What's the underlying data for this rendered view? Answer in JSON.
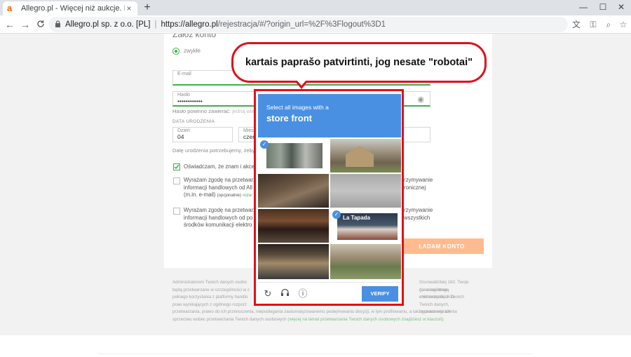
{
  "browser": {
    "tab_favicon": "a",
    "tab_title": "Allegro.pl - Więcej niż aukcje. Na",
    "tab_close": "×",
    "new_tab": "+",
    "win_min": "—",
    "win_max": "☐",
    "win_close": "✕",
    "url_org": "Allegro.pl sp. z o.o. [PL]",
    "url_host": "https://allegro.pl",
    "url_path": "/rejestracja/#/?origin_url=%2F%3Flogout%3D1"
  },
  "form": {
    "heading": "Załóż konto",
    "account_type": "zwykłe",
    "email_label": "E-mail",
    "password_label": "Hasło",
    "password_value": "••••••••••••",
    "password_hint": "Hasło powinno zawierać:",
    "password_hint_rule": "jedną wielką",
    "dob_heading": "DATA URODZENIA",
    "day_label": "Dzień",
    "day_value": "04",
    "month_label": "Mies",
    "month_value": "czer",
    "dob_hint": "Datę urodzenia potrzebujemy, żeby mó",
    "terms_text": "Oświadczam, że znam i akcep",
    "consent1_l1": "Wyrażam zgodę na przetwarz",
    "consent1_l1_right": "rzymywanie",
    "consent1_l2": "informacji handlowych od All",
    "consent1_l2_right": "ronicznej",
    "consent1_l3": "(m.in. e-mail)",
    "consent1_opt": "(opcjonalnie)",
    "consent1_more": "rozw",
    "consent2_l1": "Wyrażam zgodę na przetwarz",
    "consent2_l1_right": "rzymywanie",
    "consent2_l2": "informacji handlowych od po",
    "consent2_l2_right": "wszystkich",
    "consent2_l3": "środków komunikacji elektro",
    "submit": "ZAKŁADAM KONTO",
    "submit_visible": "ŁADAM KONTO"
  },
  "footer": {
    "l1a": "Administratorem Twoich danych osobo",
    "l1b": "Grunwaldzkiej 182. Twoje dane osobowe",
    "l2a": "będą przetwarzane w szczególności w c",
    "l2b": "ga usługi drogą elektroniczną oraz",
    "l3a": "pełnego korzystania z platformy handlo",
    "l3b": "enie wszystkich Twoich",
    "l4a": "praw wynikających z ogólnego rozporz",
    "l4b": "Twoich danych, ograniczenia ich",
    "l5": "przetwarzania, prawo do ich przenoszenia, niepodlegania zautomatyzowanemu podejmowaniu decyzji, w tym profilowaniu, a także prawo wyrażenia",
    "l6": "sprzeciwu wobec przetwarzania Twoich danych osobowych",
    "l6_link": "(więcej na temat przetwarzania Twoich danych osobowych znajdziesz w klauzuli)."
  },
  "callout": {
    "text": "kartais paprašo patvirtinti, jog nesate \"robotai\""
  },
  "captcha": {
    "instruction": "Select all images with a",
    "target": "store front",
    "verify": "VERIFY",
    "check_mark": "✓",
    "tiles": [
      {
        "selected": true
      },
      {
        "selected": false
      },
      {
        "selected": false
      },
      {
        "selected": false
      },
      {
        "selected": false
      },
      {
        "selected": true
      },
      {
        "selected": false
      },
      {
        "selected": false
      }
    ],
    "tile_sign_text": "La Tapada"
  },
  "colors": {
    "accent_green": "#3eb04a",
    "captcha_blue": "#4a90e2",
    "annotation_red": "#e0101a",
    "allegro_orange": "#ff5a00"
  },
  "icons": {
    "back": "←",
    "forward": "→",
    "reload": "C",
    "lock": "🔒",
    "translate": "文",
    "key": "⚿",
    "zoom": "⌕",
    "star": "☆",
    "captcha_reload": "↻",
    "captcha_audio": "🎧",
    "captcha_info": "ⓘ",
    "eye": "◉"
  }
}
